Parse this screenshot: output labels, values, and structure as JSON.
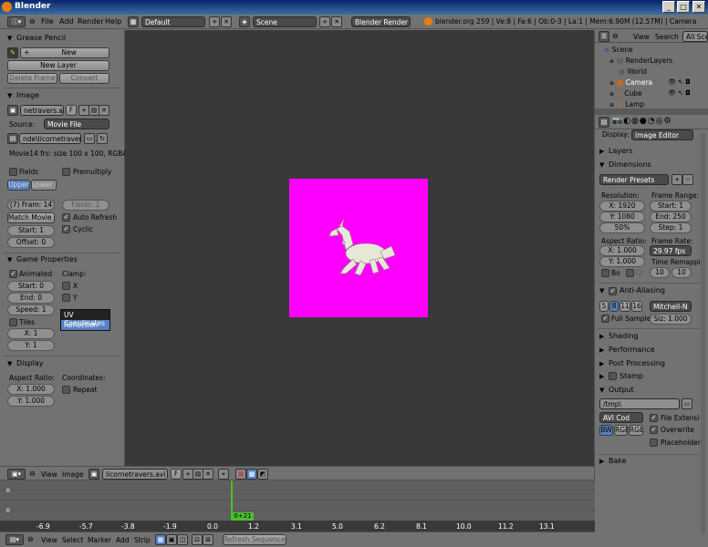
{
  "window": {
    "title": "Blender",
    "min": "_",
    "max": "□",
    "close": "✕"
  },
  "menubar": {
    "items": [
      "File",
      "Add",
      "Render",
      "Help"
    ],
    "layout": "Default",
    "scene": "Scene",
    "engine": "Blender Render",
    "stats": "blender.org 259 | Ve:8 | Fa:6 | Ob:0-3 | La:1 | Mem:6.90M (12.57M) | Camera"
  },
  "left": {
    "grease": {
      "title": "Grease Pencil",
      "new": "New",
      "new_layer": "New Layer",
      "delete_frame": "Delete Frame",
      "convert": "Convert"
    },
    "image": {
      "title": "Image",
      "name": "netravers.avi",
      "f": "F",
      "source_label": "Source:",
      "source": "Movie File",
      "path": "nde\\licornetravers.avi",
      "info": "Movie14 frs: size 100 x 100, RGBA",
      "fields": "Fields",
      "premultiply": "Premultiply",
      "upper": "Upper F",
      "lower": "Lower Fi",
      "frames": "(7) Fram: 14",
      "fields_val": "Fields: 2",
      "match": "Match Movie Len",
      "auto_refresh": "Auto Refresh",
      "start": "Start: 1",
      "cyclic": "Cyclic",
      "offset": "Offset: 0"
    },
    "game": {
      "title": "Game Properties",
      "animated": "Animated",
      "clamp": "Clamp:",
      "start": "Start: 0",
      "x": "X",
      "end": "End: 0",
      "y": "Y",
      "speed": "Speed: 1",
      "tiles": "Tiles",
      "tx": "X: 1",
      "ty": "Y: 1",
      "uv": "UV Coordinates",
      "reflection": "Reflection"
    },
    "display": {
      "title": "Display",
      "aspect": "Aspect Ratio:",
      "coords": "Coordinates:",
      "ax": "X: 1.000",
      "ay": "Y: 1.000",
      "repeat": "Repeat"
    }
  },
  "outliner": {
    "view": "View",
    "search": "Search",
    "all": "All Scen",
    "items": [
      "Scene",
      "RenderLayers",
      "World",
      "Camera",
      "Cube",
      "Lamp"
    ]
  },
  "props": {
    "display_label": "Display:",
    "display": "Image Editor",
    "layers": "Layers",
    "dimensions": "Dimensions",
    "presets": "Render Presets",
    "resolution": "Resolution:",
    "frame_range": "Frame Range:",
    "resx": "X: 1920",
    "start": "Start: 1",
    "resy": "Y: 1080",
    "end": "End: 250",
    "pct": "50%",
    "step": "Step: 1",
    "aspect": "Aspect Ratio:",
    "frame_rate": "Frame Rate:",
    "ax": "X: 1.000",
    "fps": "29.97 fps",
    "ay": "Y: 1.000",
    "remap": "Time Remappi",
    "bo": "Bo",
    "cr": "Cr",
    "old": "10",
    "new": "10",
    "aa": "Anti-Aliasing",
    "s5": "5",
    "s8": "8",
    "s11": "11",
    "s16": "16",
    "filter": "Mitchell-N",
    "full": "Full Sample",
    "size": "Siz: 1.000",
    "shading": "Shading",
    "performance": "Performance",
    "post": "Post Processing",
    "stamp": "Stamp",
    "output": "Output",
    "path": "/tmp\\",
    "codec": "AVI Cod",
    "file_ext": "File Extensi",
    "bw": "BW",
    "rgb": "RGB",
    "rgba": "RGB",
    "overwrite": "Overwrite",
    "placeholder": "Placeholder",
    "bake": "Bake"
  },
  "imgheader": {
    "view": "View",
    "image": "Image",
    "name": "licornetravers.avi",
    "f": "F"
  },
  "timeline": {
    "ticks": [
      "-6.9",
      "-5.7",
      "-3.8",
      "-1.9",
      "0.0",
      "1.2",
      "3.1",
      "5.0",
      "6.2",
      "8.1",
      "10.0",
      "11.2",
      "13.1"
    ],
    "marker": "0+21",
    "menus": [
      "View",
      "Select",
      "Marker",
      "Add",
      "Strip"
    ],
    "refresh": "Refresh Sequencer"
  },
  "colors": {
    "canvas": "#ff00ff",
    "accent": "#5680c2"
  }
}
